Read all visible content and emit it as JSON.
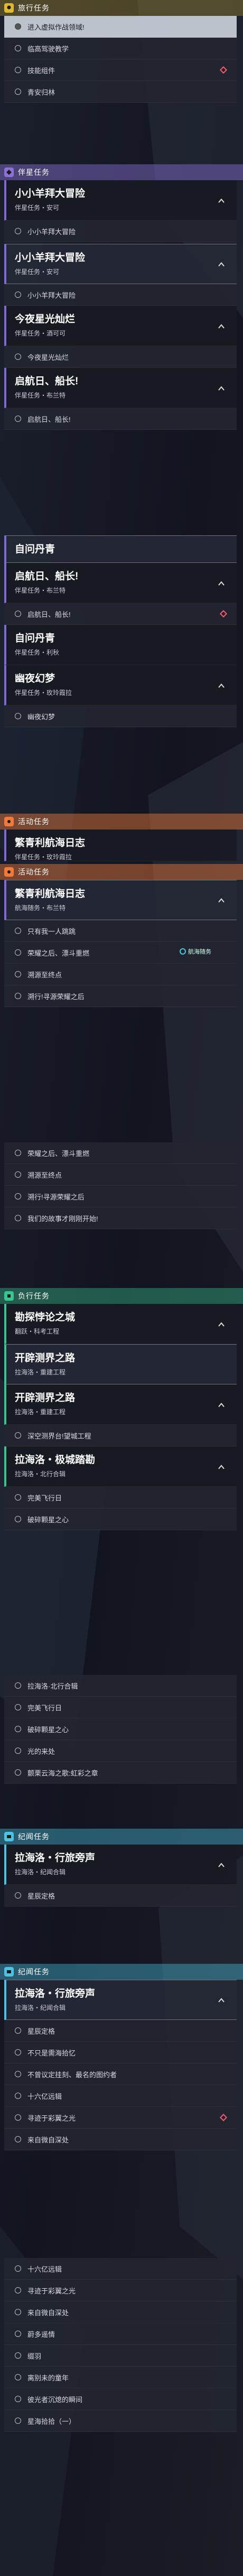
{
  "colors": {
    "travel": "#ddb830",
    "companion": "#8a72d6",
    "event": "#f07a3a",
    "ranger": "#39c492",
    "anomaly": "#4cc3e3"
  },
  "rows": {
    "r1": "进入虚拟作战领域!",
    "r2": "临高驾驶教学",
    "r3": "技能组件",
    "r4": "青安归林",
    "r5": "小小羊拜大冒险",
    "r6": "小小羊拜大冒险",
    "r7": "今夜星光灿烂",
    "r8": "启航日、船长!",
    "r9": "启航日、船长!",
    "r10": "幽夜幻梦",
    "r11": "只有我一人跳跳",
    "r12": "荣耀之后、漂斗重燃",
    "r13": "溯源至终点",
    "r14": "溯行!寻源荣耀之后",
    "r15": "荣耀之后、漂斗重燃",
    "r16": "溯源至终点",
    "r17": "溯行!寻源荣耀之后",
    "r18": "我们的故事才刚刚开始!",
    "r19": "深空测界台!望城工程",
    "r20": "完美飞行日",
    "r21": "破碎颗星之心",
    "r22": "拉海洛·北行合辑",
    "r23": "完美飞行日",
    "r24": "破碎颗星之心",
    "r25": "光的来处",
    "r26": "颤栗云海之歌:虹彩之章",
    "r27": "星辰定格",
    "r28": "星辰定格",
    "r29": "不只是需海拾忆",
    "r30": "不曾议定挂刻、最名的图约者",
    "r31": "十六亿远辑",
    "r32": "寻迹于彩翼之光",
    "r33": "来自微自深处",
    "r34": "十六亿远辑",
    "r35": "寻迹于彩翼之光",
    "r36": "来自微自深处",
    "r37": "蔚多遥情",
    "r38": "缀羽",
    "r39": "离别未的童年",
    "r40": "彼光者沉熄的瞬间",
    "r41": "星海拾拾（一）"
  },
  "headers": {
    "h1": "旅行任务",
    "h2": "伴星任务",
    "h3": "活动任务",
    "h4": "活动任务",
    "h5": "负行任务",
    "h6": "纪闻任务",
    "h7": "纪闻任务"
  },
  "cards": {
    "c1": {
      "title": "小小羊拜大冒险",
      "sub": "伴星任务・安可"
    },
    "c2": {
      "title": "小小羊拜大冒险",
      "sub": "伴星任务・安可"
    },
    "c3": {
      "title": "今夜星光灿烂",
      "sub": "伴星任务・酒可可"
    },
    "c4": {
      "title": "启航日、船长!",
      "sub": "伴星任务・布兰特"
    },
    "c5": {
      "title": "自问丹青",
      "sub": ""
    },
    "c6": {
      "title": "启航日、船长!",
      "sub": "伴星任务・布兰特"
    },
    "c7": {
      "title": "自问丹青",
      "sub": "伴星任务・利秋"
    },
    "c8": {
      "title": "幽夜幻梦",
      "sub": "伴星任务・玫玲霞拉"
    },
    "c9": {
      "title": "繁青利航海日志",
      "sub": "伴星任务・玫玲霞拉"
    },
    "c10": {
      "title": "繁青利航海日志",
      "sub": "航海随务・布兰特"
    },
    "c11": {
      "title": "勘探悖论之城",
      "sub": "翻跃・科考工程"
    },
    "c12": {
      "title": "开辟测界之路",
      "sub": "拉海洛・重建工程"
    },
    "c13": {
      "title": "开辟测界之路",
      "sub": "拉海洛・重建工程"
    },
    "c14": {
      "title": "拉海洛・极城踏勘",
      "sub": "拉海洛・北行合辑"
    },
    "c15": {
      "title": "拉海洛・行旅旁声",
      "sub": "拉海洛・纪闻合辑"
    },
    "c16": {
      "title": "拉海洛・行旅旁声",
      "sub": "拉海洛・纪闻合辑"
    }
  },
  "tag_label": "航海随务"
}
